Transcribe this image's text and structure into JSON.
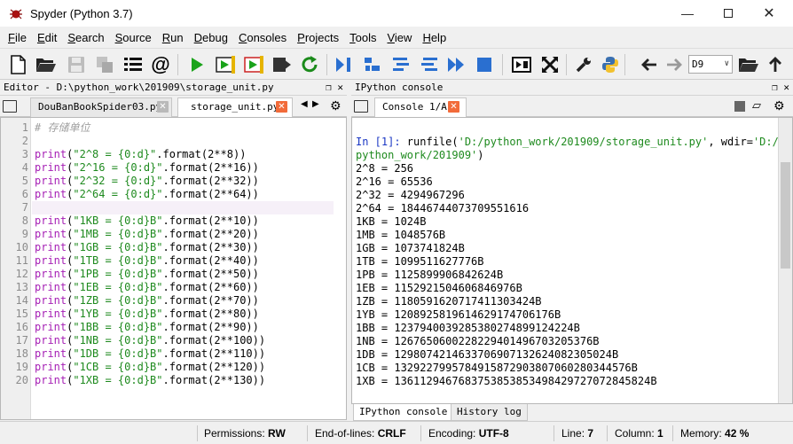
{
  "window": {
    "title": "Spyder (Python 3.7)"
  },
  "menu": [
    "File",
    "Edit",
    "Search",
    "Source",
    "Run",
    "Debug",
    "Consoles",
    "Projects",
    "Tools",
    "View",
    "Help"
  ],
  "menu_underline_first": true,
  "toolbar": {
    "path_combo_value": "D9",
    "buttons": [
      "new-file",
      "open-file",
      "save-file",
      "save-all",
      "list",
      "at-sign",
      "run",
      "run-cell",
      "run-cell-advance",
      "run-selection",
      "rerun-config",
      "debug",
      "step",
      "step-into",
      "step-return",
      "continue",
      "stop-debug",
      "maximize-pane",
      "fullscreen",
      "preferences",
      "python-path",
      "back",
      "forward",
      "browse",
      "up"
    ]
  },
  "editor": {
    "header": "Editor - D:\\python_work\\201909\\storage_unit.py",
    "tabs": [
      {
        "label": "DouBanBookSpider03.py",
        "active": false
      },
      {
        "label": "storage_unit.py",
        "active": true
      }
    ],
    "current_line": 7,
    "lines": [
      {
        "no": "1",
        "segments": [
          {
            "t": "# 存储单位",
            "c": "comment"
          }
        ]
      },
      {
        "no": "2",
        "segments": []
      },
      {
        "no": "3",
        "segments": [
          {
            "t": "print",
            "c": "kw"
          },
          {
            "t": "(",
            "c": "def"
          },
          {
            "t": "\"2^8 = {0:d}\"",
            "c": "str"
          },
          {
            "t": ".format(2**8))",
            "c": "def"
          }
        ]
      },
      {
        "no": "4",
        "segments": [
          {
            "t": "print",
            "c": "kw"
          },
          {
            "t": "(",
            "c": "def"
          },
          {
            "t": "\"2^16 = {0:d}\"",
            "c": "str"
          },
          {
            "t": ".format(2**16))",
            "c": "def"
          }
        ]
      },
      {
        "no": "5",
        "segments": [
          {
            "t": "print",
            "c": "kw"
          },
          {
            "t": "(",
            "c": "def"
          },
          {
            "t": "\"2^32 = {0:d}\"",
            "c": "str"
          },
          {
            "t": ".format(2**32))",
            "c": "def"
          }
        ]
      },
      {
        "no": "6",
        "segments": [
          {
            "t": "print",
            "c": "kw"
          },
          {
            "t": "(",
            "c": "def"
          },
          {
            "t": "\"2^64 = {0:d}\"",
            "c": "str"
          },
          {
            "t": ".format(2**64))",
            "c": "def"
          }
        ]
      },
      {
        "no": "7",
        "segments": []
      },
      {
        "no": "8",
        "segments": [
          {
            "t": "print",
            "c": "kw"
          },
          {
            "t": "(",
            "c": "def"
          },
          {
            "t": "\"1KB = {0:d}B\"",
            "c": "str"
          },
          {
            "t": ".format(2**10))",
            "c": "def"
          }
        ]
      },
      {
        "no": "9",
        "segments": [
          {
            "t": "print",
            "c": "kw"
          },
          {
            "t": "(",
            "c": "def"
          },
          {
            "t": "\"1MB = {0:d}B\"",
            "c": "str"
          },
          {
            "t": ".format(2**20))",
            "c": "def"
          }
        ]
      },
      {
        "no": "10",
        "segments": [
          {
            "t": "print",
            "c": "kw"
          },
          {
            "t": "(",
            "c": "def"
          },
          {
            "t": "\"1GB = {0:d}B\"",
            "c": "str"
          },
          {
            "t": ".format(2**30))",
            "c": "def"
          }
        ]
      },
      {
        "no": "11",
        "segments": [
          {
            "t": "print",
            "c": "kw"
          },
          {
            "t": "(",
            "c": "def"
          },
          {
            "t": "\"1TB = {0:d}B\"",
            "c": "str"
          },
          {
            "t": ".format(2**40))",
            "c": "def"
          }
        ]
      },
      {
        "no": "12",
        "segments": [
          {
            "t": "print",
            "c": "kw"
          },
          {
            "t": "(",
            "c": "def"
          },
          {
            "t": "\"1PB = {0:d}B\"",
            "c": "str"
          },
          {
            "t": ".format(2**50))",
            "c": "def"
          }
        ]
      },
      {
        "no": "13",
        "segments": [
          {
            "t": "print",
            "c": "kw"
          },
          {
            "t": "(",
            "c": "def"
          },
          {
            "t": "\"1EB = {0:d}B\"",
            "c": "str"
          },
          {
            "t": ".format(2**60))",
            "c": "def"
          }
        ]
      },
      {
        "no": "14",
        "segments": [
          {
            "t": "print",
            "c": "kw"
          },
          {
            "t": "(",
            "c": "def"
          },
          {
            "t": "\"1ZB = {0:d}B\"",
            "c": "str"
          },
          {
            "t": ".format(2**70))",
            "c": "def"
          }
        ]
      },
      {
        "no": "15",
        "segments": [
          {
            "t": "print",
            "c": "kw"
          },
          {
            "t": "(",
            "c": "def"
          },
          {
            "t": "\"1YB = {0:d}B\"",
            "c": "str"
          },
          {
            "t": ".format(2**80))",
            "c": "def"
          }
        ]
      },
      {
        "no": "16",
        "segments": [
          {
            "t": "print",
            "c": "kw"
          },
          {
            "t": "(",
            "c": "def"
          },
          {
            "t": "\"1BB = {0:d}B\"",
            "c": "str"
          },
          {
            "t": ".format(2**90))",
            "c": "def"
          }
        ]
      },
      {
        "no": "17",
        "segments": [
          {
            "t": "print",
            "c": "kw"
          },
          {
            "t": "(",
            "c": "def"
          },
          {
            "t": "\"1NB = {0:d}B\"",
            "c": "str"
          },
          {
            "t": ".format(2**100))",
            "c": "def"
          }
        ]
      },
      {
        "no": "18",
        "segments": [
          {
            "t": "print",
            "c": "kw"
          },
          {
            "t": "(",
            "c": "def"
          },
          {
            "t": "\"1DB = {0:d}B\"",
            "c": "str"
          },
          {
            "t": ".format(2**110))",
            "c": "def"
          }
        ]
      },
      {
        "no": "19",
        "segments": [
          {
            "t": "print",
            "c": "kw"
          },
          {
            "t": "(",
            "c": "def"
          },
          {
            "t": "\"1CB = {0:d}B\"",
            "c": "str"
          },
          {
            "t": ".format(2**120))",
            "c": "def"
          }
        ]
      },
      {
        "no": "20",
        "segments": [
          {
            "t": "print",
            "c": "kw"
          },
          {
            "t": "(",
            "c": "def"
          },
          {
            "t": "\"1XB = {0:d}B\"",
            "c": "str"
          },
          {
            "t": ".format(2**130))",
            "c": "def"
          }
        ]
      }
    ]
  },
  "console": {
    "header": "IPython console",
    "tab_label": "Console 1/A",
    "lines": [
      {
        "segments": [
          {
            "t": "In [1]: ",
            "c": "prompt"
          },
          {
            "t": "runfile(",
            "c": "def"
          },
          {
            "t": "'D:/python_work/201909/storage_unit.py'",
            "c": "cstr"
          },
          {
            "t": ", wdir=",
            "c": "def"
          },
          {
            "t": "'D:/",
            "c": "cstr"
          }
        ]
      },
      {
        "segments": [
          {
            "t": "python_work/201909'",
            "c": "cstr"
          },
          {
            "t": ")",
            "c": "def"
          }
        ]
      },
      {
        "segments": [
          {
            "t": "2^8 = 256",
            "c": "def"
          }
        ]
      },
      {
        "segments": [
          {
            "t": "2^16 = 65536",
            "c": "def"
          }
        ]
      },
      {
        "segments": [
          {
            "t": "2^32 = 4294967296",
            "c": "def"
          }
        ]
      },
      {
        "segments": [
          {
            "t": "2^64 = 18446744073709551616",
            "c": "def"
          }
        ]
      },
      {
        "segments": [
          {
            "t": "1KB = 1024B",
            "c": "def"
          }
        ]
      },
      {
        "segments": [
          {
            "t": "1MB = 1048576B",
            "c": "def"
          }
        ]
      },
      {
        "segments": [
          {
            "t": "1GB = 1073741824B",
            "c": "def"
          }
        ]
      },
      {
        "segments": [
          {
            "t": "1TB = 1099511627776B",
            "c": "def"
          }
        ]
      },
      {
        "segments": [
          {
            "t": "1PB = 1125899906842624B",
            "c": "def"
          }
        ]
      },
      {
        "segments": [
          {
            "t": "1EB = 1152921504606846976B",
            "c": "def"
          }
        ]
      },
      {
        "segments": [
          {
            "t": "1ZB = 1180591620717411303424B",
            "c": "def"
          }
        ]
      },
      {
        "segments": [
          {
            "t": "1YB = 1208925819614629174706176B",
            "c": "def"
          }
        ]
      },
      {
        "segments": [
          {
            "t": "1BB = 1237940039285380274899124224B",
            "c": "def"
          }
        ]
      },
      {
        "segments": [
          {
            "t": "1NB = 1267650600228229401496703205376B",
            "c": "def"
          }
        ]
      },
      {
        "segments": [
          {
            "t": "1DB = 1298074214633706907132624082305024B",
            "c": "def"
          }
        ]
      },
      {
        "segments": [
          {
            "t": "1CB = 1329227995784915872903807060280344576B",
            "c": "def"
          }
        ]
      },
      {
        "segments": [
          {
            "t": "1XB = 1361129467683753853853498429727072845824B",
            "c": "def"
          }
        ]
      }
    ],
    "bottom_tabs": [
      {
        "label": "IPython console",
        "active": true
      },
      {
        "label": "History log",
        "active": false
      }
    ]
  },
  "statusbar": {
    "permissions_label": "Permissions:",
    "permissions_value": "RW",
    "eol_label": "End-of-lines:",
    "eol_value": "CRLF",
    "encoding_label": "Encoding:",
    "encoding_value": "UTF-8",
    "line_label": "Line:",
    "line_value": "7",
    "column_label": "Column:",
    "column_value": "1",
    "memory_label": "Memory:",
    "memory_value": "42 %"
  },
  "colors": {
    "keyword": "#a620b5",
    "string": "#1e8a1e",
    "comment": "#a0a0a0",
    "prompt": "#1a37c4",
    "close_tab": "#f26b3a",
    "run_green": "#1aa31a",
    "debug_blue": "#2a6fd0"
  }
}
